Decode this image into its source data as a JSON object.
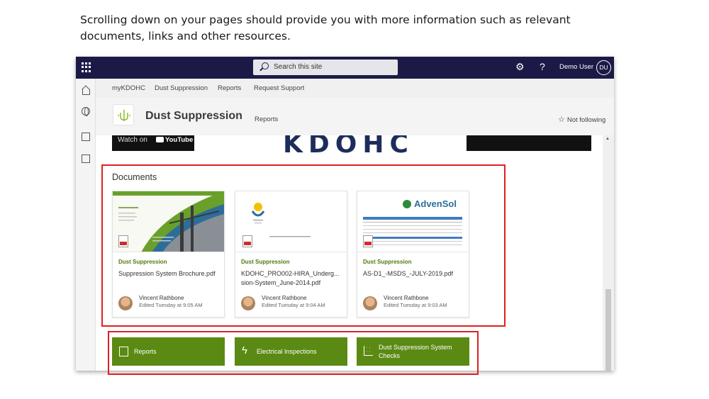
{
  "caption": "Scrolling down on your pages should provide you with more information such as relevant documents, links and other resources.",
  "topbar": {
    "search_placeholder": "Search this site",
    "user_name": "Demo User",
    "user_initials": "DU",
    "help_label": "?"
  },
  "sitenav": {
    "items": [
      "myKDOHC",
      "Dust Suppression",
      "Reports",
      "Request Support"
    ]
  },
  "header": {
    "title": "Dust Suppression",
    "nav_link": "Reports",
    "follow_label": "Not following"
  },
  "video": {
    "watch_on": "Watch on",
    "youtube": "YouTube",
    "banner_text": "KDOHC"
  },
  "documents": {
    "heading": "Documents",
    "cards": [
      {
        "library": "Dust Suppression",
        "file_name": "Suppression System Brochure.pdf",
        "editor": "Vincent Rathbone",
        "edited": "Edited Tuesday at 9:05 AM"
      },
      {
        "library": "Dust Suppression",
        "file_name": "KDOHC_PRO002-HIRA_Underg... sion-System_June-2014.pdf",
        "editor": "Vincent Rathbone",
        "edited": "Edited Tuesday at 9:04 AM"
      },
      {
        "library": "Dust Suppression",
        "file_name": "AS-D1_-MSDS_-JULY-2019.pdf",
        "editor": "Vincent Rathbone",
        "edited": "Edited Tuesday at 9:03 AM",
        "thumb_brand": "AdvenSol"
      }
    ]
  },
  "quicklinks": [
    {
      "label": "Reports",
      "icon": "report-icon"
    },
    {
      "label": "Electrical Inspections",
      "icon": "lightning-icon"
    },
    {
      "label": "Dust Suppression System Checks",
      "icon": "scatter-chart-icon"
    }
  ],
  "colors": {
    "suite_bar": "#1b1a47",
    "accent_green": "#5a8a14",
    "highlight_red": "#e02020"
  }
}
